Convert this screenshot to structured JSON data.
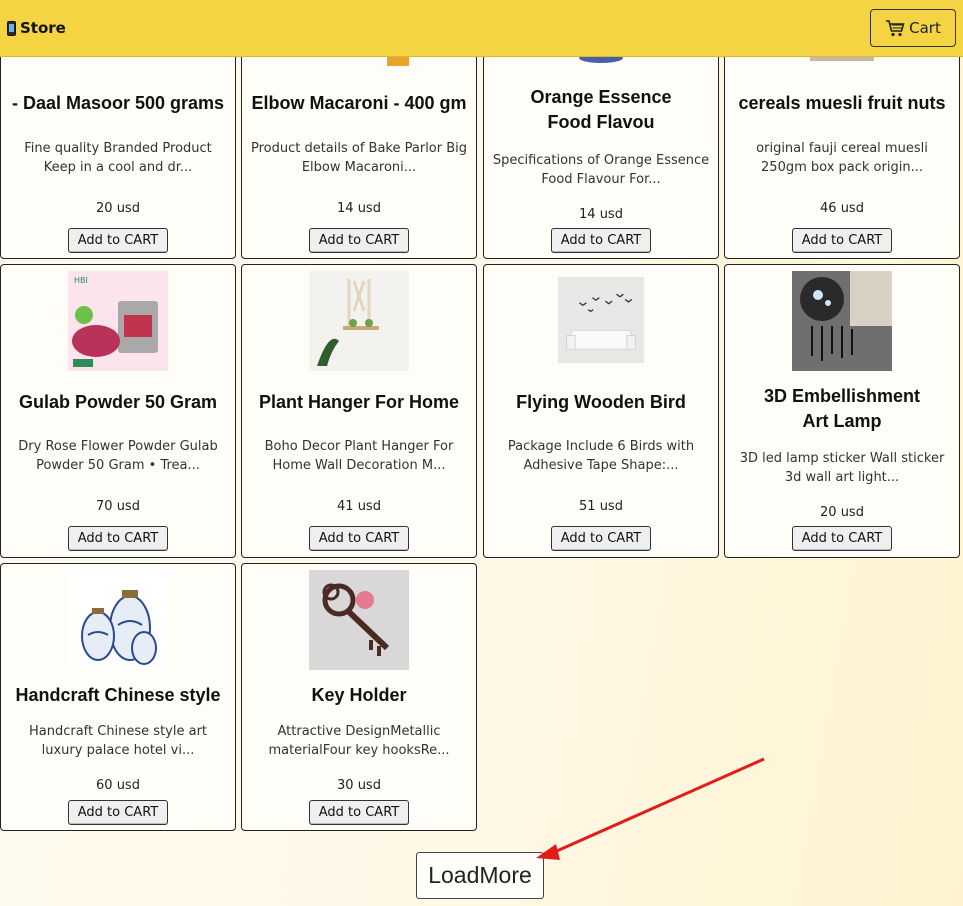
{
  "navbar": {
    "brand_icon": "mobile-phone-icon",
    "brand": "Store",
    "cart_icon": "shopping-cart-icon",
    "cart_label": "Cart",
    "background": "#f4d442"
  },
  "products": [
    {
      "title": "- Daal Masoor 500 grams",
      "desc": "Fine quality Branded Product Keep in a cool and dr...",
      "price": "20 usd",
      "button": "Add to CART",
      "image": "daal-masoor-image"
    },
    {
      "title": "Elbow Macaroni - 400 gm",
      "desc": "Product details of Bake Parlor Big Elbow Macaroni...",
      "price": "14 usd",
      "button": "Add to CART",
      "image": "macaroni-image"
    },
    {
      "title": "Orange Essence Food Flavou",
      "desc": "Specifications of Orange Essence Food Flavour For...",
      "price": "14 usd",
      "button": "Add to CART",
      "image": "orange-essence-image"
    },
    {
      "title": "cereals muesli fruit nuts",
      "desc": "original fauji cereal muesli 250gm box pack origin...",
      "price": "46 usd",
      "button": "Add to CART",
      "image": "muesli-image"
    },
    {
      "title": "Gulab Powder 50 Gram",
      "desc": "Dry Rose Flower Powder Gulab Powder 50 Gram • Trea...",
      "price": "70 usd",
      "button": "Add to CART",
      "image": "rose-powder-image"
    },
    {
      "title": "Plant Hanger For Home",
      "desc": "Boho Decor Plant Hanger For Home Wall Decoration M...",
      "price": "41 usd",
      "button": "Add to CART",
      "image": "plant-hanger-image"
    },
    {
      "title": "Flying Wooden Bird",
      "desc": "Package Include 6 Birds with Adhesive Tape Shape:...",
      "price": "51 usd",
      "button": "Add to CART",
      "image": "wooden-birds-image"
    },
    {
      "title": "3D Embellishment Art Lamp",
      "desc": "3D led lamp sticker Wall sticker 3d wall art light...",
      "price": "20 usd",
      "button": "Add to CART",
      "image": "art-lamp-image"
    },
    {
      "title": "Handcraft Chinese style",
      "desc": "Handcraft Chinese style art luxury palace hotel vi...",
      "price": "60 usd",
      "button": "Add to CART",
      "image": "chinese-vases-image"
    },
    {
      "title": "Key Holder",
      "desc": "Attractive DesignMetallic materialFour key hooksRe...",
      "price": "30 usd",
      "button": "Add to CART",
      "image": "key-holder-image"
    }
  ],
  "load_more": "LoadMore",
  "annotation_color": "#e31b1b"
}
